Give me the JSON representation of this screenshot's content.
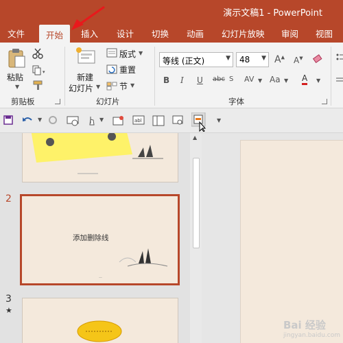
{
  "window": {
    "title": "演示文稿1  -  PowerPoint"
  },
  "tabs": [
    {
      "label": "文件"
    },
    {
      "label": "开始"
    },
    {
      "label": "插入"
    },
    {
      "label": "设计"
    },
    {
      "label": "切换"
    },
    {
      "label": "动画"
    },
    {
      "label": "幻灯片放映"
    },
    {
      "label": "审阅"
    },
    {
      "label": "视图"
    }
  ],
  "ribbon": {
    "clipboard": {
      "paste_label": "粘贴",
      "group_label": "剪贴板"
    },
    "slides": {
      "new_slide_line1": "新建",
      "new_slide_line2": "幻灯片",
      "layout_label": "版式",
      "reset_label": "重置",
      "section_label": "节",
      "group_label": "幻灯片"
    },
    "font": {
      "font_name": "等线 (正文)",
      "font_size": "48",
      "bold": "B",
      "italic": "I",
      "underline": "U",
      "strikethrough": "abc",
      "spacing": "AV",
      "change_case": "Aa",
      "font_color": "A",
      "group_label": "字体"
    }
  },
  "slides": [
    {
      "number": "",
      "thumbnail_text": ""
    },
    {
      "number": "2",
      "thumbnail_text": "添加删除线"
    },
    {
      "number": "3",
      "thumbnail_text": "",
      "starred": "★"
    }
  ],
  "watermark": {
    "text": "Bai 经验",
    "sub": "jingyan.baidu.com"
  },
  "colors": {
    "accent": "#b7472a",
    "slide_bg": "#f4e9dc",
    "note_yellow": "#fff35c"
  }
}
